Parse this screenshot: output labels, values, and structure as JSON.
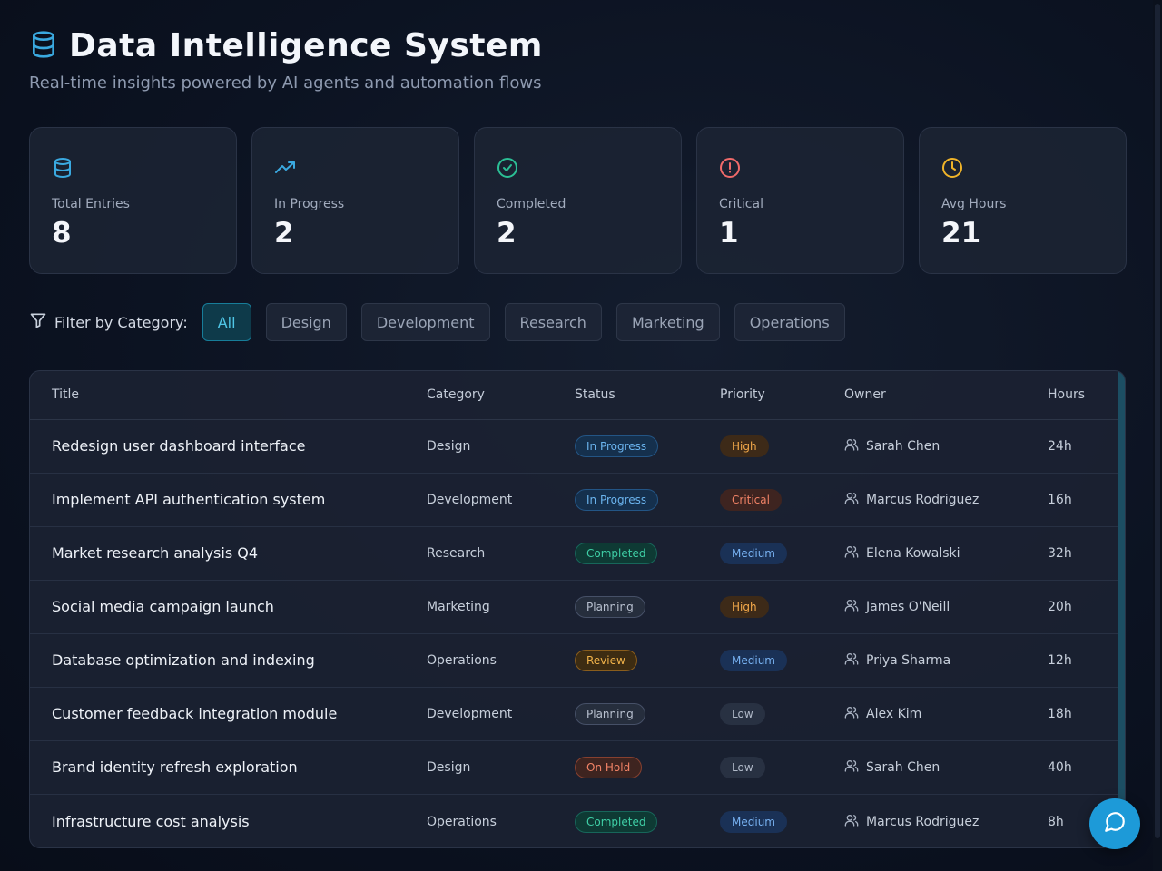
{
  "header": {
    "title": "Data Intelligence System",
    "subtitle": "Real-time insights powered by AI agents and automation flows",
    "icon": "database-icon"
  },
  "stats": [
    {
      "label": "Total Entries",
      "value": "8",
      "icon": "database-icon",
      "color": "#3aa9e0"
    },
    {
      "label": "In Progress",
      "value": "2",
      "icon": "trending-up-icon",
      "color": "#3aa9e0"
    },
    {
      "label": "Completed",
      "value": "2",
      "icon": "check-circle-icon",
      "color": "#2bbf95"
    },
    {
      "label": "Critical",
      "value": "1",
      "icon": "alert-circle-icon",
      "color": "#f06a6a"
    },
    {
      "label": "Avg Hours",
      "value": "21",
      "icon": "clock-icon",
      "color": "#f0b429"
    }
  ],
  "filters": {
    "label": "Filter by Category:",
    "options": [
      "All",
      "Design",
      "Development",
      "Research",
      "Marketing",
      "Operations"
    ],
    "active": "All"
  },
  "table": {
    "columns": [
      "Title",
      "Category",
      "Status",
      "Priority",
      "Owner",
      "Hours"
    ],
    "rows": [
      {
        "title": "Redesign user dashboard interface",
        "category": "Design",
        "status": "In Progress",
        "priority": "High",
        "owner": "Sarah Chen",
        "hours": "24h"
      },
      {
        "title": "Implement API authentication system",
        "category": "Development",
        "status": "In Progress",
        "priority": "Critical",
        "owner": "Marcus Rodriguez",
        "hours": "16h"
      },
      {
        "title": "Market research analysis Q4",
        "category": "Research",
        "status": "Completed",
        "priority": "Medium",
        "owner": "Elena Kowalski",
        "hours": "32h"
      },
      {
        "title": "Social media campaign launch",
        "category": "Marketing",
        "status": "Planning",
        "priority": "High",
        "owner": "James O'Neill",
        "hours": "20h"
      },
      {
        "title": "Database optimization and indexing",
        "category": "Operations",
        "status": "Review",
        "priority": "Medium",
        "owner": "Priya Sharma",
        "hours": "12h"
      },
      {
        "title": "Customer feedback integration module",
        "category": "Development",
        "status": "Planning",
        "priority": "Low",
        "owner": "Alex Kim",
        "hours": "18h"
      },
      {
        "title": "Brand identity refresh exploration",
        "category": "Design",
        "status": "On Hold",
        "priority": "Low",
        "owner": "Sarah Chen",
        "hours": "40h"
      },
      {
        "title": "Infrastructure cost analysis",
        "category": "Operations",
        "status": "Completed",
        "priority": "Medium",
        "owner": "Marcus Rodriguez",
        "hours": "8h"
      }
    ]
  },
  "badge_colors": {
    "In Progress": {
      "bg": "#15304d",
      "border": "#235585",
      "text": "#6bb4ee"
    },
    "Completed": {
      "bg": "#0e3a34",
      "border": "#17665a",
      "text": "#3fcfa6"
    },
    "Planning": {
      "bg": "#262e3d",
      "border": "#465067",
      "text": "#b8c0cf"
    },
    "Review": {
      "bg": "#3d2c12",
      "border": "#8a5d1c",
      "text": "#f0b24a"
    },
    "On Hold": {
      "bg": "#3e2420",
      "border": "#87402f",
      "text": "#f08266"
    },
    "High": {
      "bg": "#3d2a18",
      "border": "#3d2a18",
      "text": "#f3a94a"
    },
    "Critical": {
      "bg": "#3e2420",
      "border": "#3e2420",
      "text": "#f08266"
    },
    "Medium": {
      "bg": "#1a3156",
      "border": "#1a3156",
      "text": "#78b2f2"
    },
    "Low": {
      "bg": "#283142",
      "border": "#283142",
      "text": "#b1bac9"
    }
  },
  "chat_button": {
    "icon": "chat-bubble-icon"
  }
}
